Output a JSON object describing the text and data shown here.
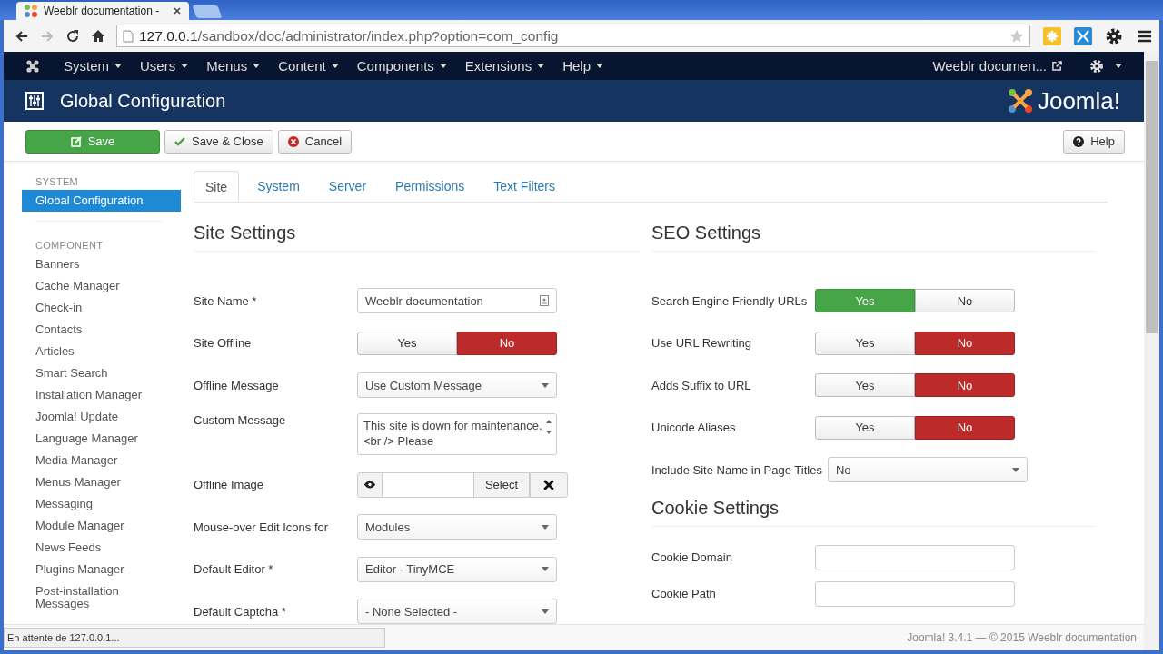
{
  "browser": {
    "tab_title": "Weeblr documentation - ",
    "url_host": "127.0.0.1",
    "url_path": "/sandbox/doc/administrator/index.php?option=com_config"
  },
  "navbar": {
    "menus": [
      "System",
      "Users",
      "Menus",
      "Content",
      "Components",
      "Extensions",
      "Help"
    ],
    "site_link": "Weeblr documen..."
  },
  "header": {
    "title": "Global Configuration",
    "logo_text": "Joomla!"
  },
  "toolbar": {
    "buttons": [
      {
        "label": "Save",
        "kind": "save"
      },
      {
        "label": "Save & Close",
        "kind": "check"
      },
      {
        "label": "Cancel",
        "kind": "cancel"
      }
    ],
    "help": "Help"
  },
  "sidebar": {
    "sections": [
      {
        "heading": "SYSTEM",
        "items": [
          {
            "label": "Global Configuration",
            "selected": true
          }
        ]
      },
      {
        "heading": "COMPONENT",
        "items": [
          {
            "label": "Banners",
            "selected": false
          },
          {
            "label": "Cache Manager",
            "selected": false
          },
          {
            "label": "Check-in",
            "selected": false
          },
          {
            "label": "Contacts",
            "selected": false
          },
          {
            "label": "Articles",
            "selected": false
          },
          {
            "label": "Smart Search",
            "selected": false
          },
          {
            "label": "Installation Manager",
            "selected": false
          },
          {
            "label": "Joomla! Update",
            "selected": false
          },
          {
            "label": "Language Manager",
            "selected": false
          },
          {
            "label": "Media Manager",
            "selected": false
          },
          {
            "label": "Menus Manager",
            "selected": false
          },
          {
            "label": "Messaging",
            "selected": false
          },
          {
            "label": "Module Manager",
            "selected": false
          },
          {
            "label": "News Feeds",
            "selected": false
          },
          {
            "label": "Plugins Manager",
            "selected": false
          },
          {
            "label": "Post-installation Messages",
            "selected": false
          }
        ]
      }
    ]
  },
  "tabs": [
    {
      "label": "Site",
      "selected": true
    },
    {
      "label": "System",
      "selected": false
    },
    {
      "label": "Server",
      "selected": false
    },
    {
      "label": "Permissions",
      "selected": false
    },
    {
      "label": "Text Filters",
      "selected": false
    }
  ],
  "columns": [
    {
      "sections": [
        {
          "title": "Site Settings",
          "fields": [
            {
              "label": "Site Name *",
              "kind": "text",
              "value": "Weeblr documentation"
            },
            {
              "label": "Site Offline",
              "kind": "toggle",
              "options": [
                "Yes",
                "No"
              ],
              "on": false
            },
            {
              "label": "Offline Message",
              "kind": "select",
              "value": "Use Custom Message"
            },
            {
              "label": "Custom Message",
              "kind": "textarea",
              "value": "This site is down for maintenance.<br /> Please"
            },
            {
              "label": "Offline Image",
              "kind": "image",
              "button": "Select"
            },
            {
              "label": "Mouse-over Edit Icons for",
              "kind": "select",
              "value": "Modules"
            },
            {
              "label": "Default Editor *",
              "kind": "select",
              "value": "Editor - TinyMCE"
            },
            {
              "label": "Default Captcha *",
              "kind": "select",
              "value": "- None Selected -"
            }
          ]
        }
      ]
    },
    {
      "sections": [
        {
          "title": "SEO Settings",
          "fields": [
            {
              "label": "Search Engine Friendly URLs",
              "kind": "toggle",
              "options": [
                "Yes",
                "No"
              ],
              "on": true
            },
            {
              "label": "Use URL Rewriting",
              "kind": "toggle",
              "options": [
                "Yes",
                "No"
              ],
              "on": false
            },
            {
              "label": "Adds Suffix to URL",
              "kind": "toggle",
              "options": [
                "Yes",
                "No"
              ],
              "on": false
            },
            {
              "label": "Unicode Aliases",
              "kind": "toggle",
              "options": [
                "Yes",
                "No"
              ],
              "on": false
            },
            {
              "label": "Include Site Name in Page Titles",
              "kind": "select",
              "value": "No"
            }
          ]
        },
        {
          "title": "Cookie Settings",
          "fields": [
            {
              "label": "Cookie Domain",
              "kind": "text"
            },
            {
              "label": "Cookie Path",
              "kind": "text"
            }
          ]
        }
      ]
    }
  ],
  "footer": "Joomla! 3.4.1 — © 2015 Weeblr documentation",
  "status": "En attente de 127.0.0.1..."
}
